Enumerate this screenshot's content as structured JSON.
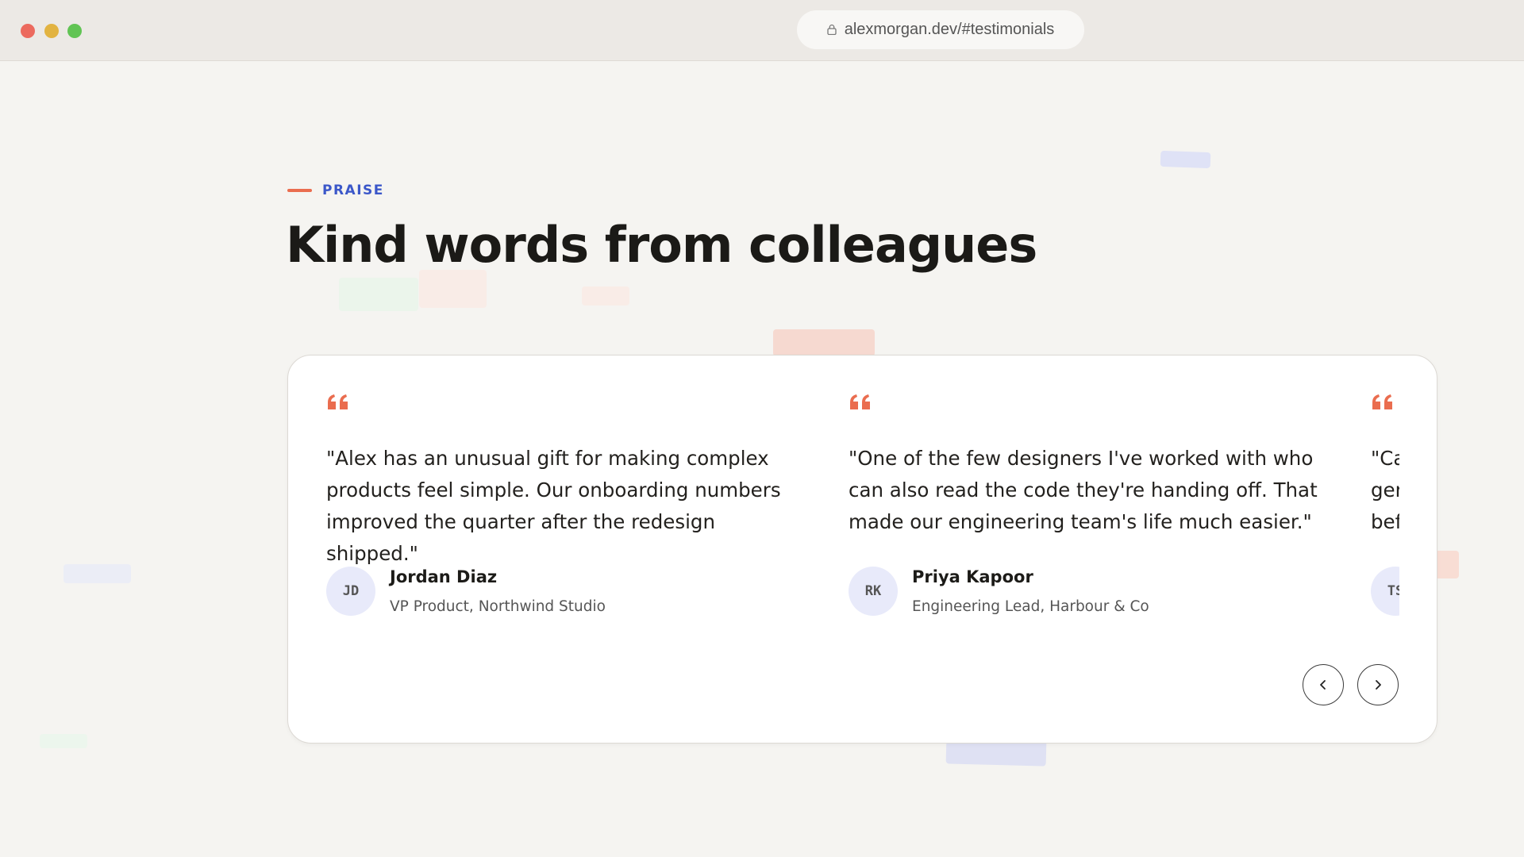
{
  "browser": {
    "url": "alexmorgan.dev/#testimonials"
  },
  "section": {
    "eyebrow": "PRAISE",
    "title": "Kind words from colleagues"
  },
  "colors": {
    "accent_orange": "#ea6d4f",
    "accent_blue": "#3b57c9",
    "background": "#f5f4f1"
  },
  "testimonials": [
    {
      "quote": "\"Alex has an unusual gift for making complex products feel simple. Our onboarding numbers improved the quarter after the redesign shipped.\"",
      "initials": "JD",
      "name": "Jordan Diaz",
      "role": "VP Product, Northwind Studio"
    },
    {
      "quote": "\"One of the few designers I've worked with who can also read the code they're handing off. That made our engineering team's life much easier.\"",
      "initials": "RK",
      "name": "Priya Kapoor",
      "role": "Engineering Lead, Harbour & Co"
    },
    {
      "quote": "\"Ca ger bef",
      "initials": "TS",
      "name": "",
      "role": ""
    }
  ],
  "carousel": {
    "prev_icon": "chevron-left-icon",
    "next_icon": "chevron-right-icon"
  }
}
